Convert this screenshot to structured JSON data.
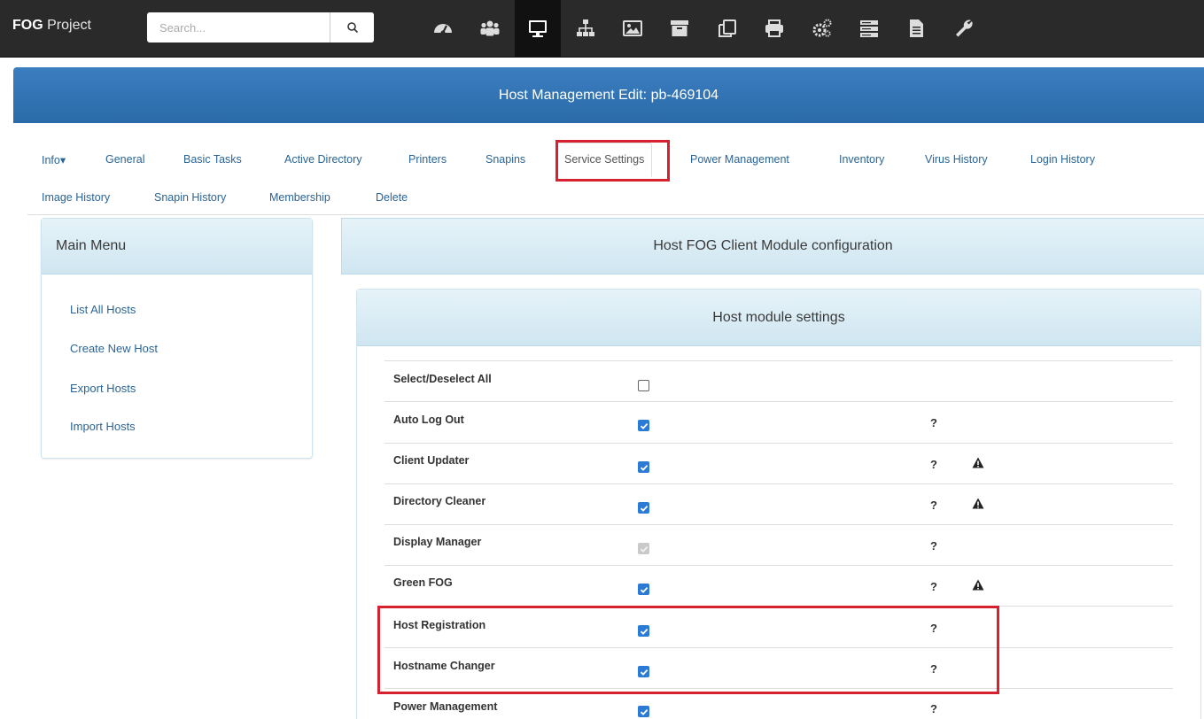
{
  "navbar": {
    "brand_bold": "FOG",
    "brand_rest": " Project",
    "search_placeholder": "Search...",
    "icons": [
      "dashboard-icon",
      "users-icon",
      "monitor-icon",
      "sitemap-icon",
      "image-icon",
      "archive-icon",
      "copy-icon",
      "printer-icon",
      "cogs-icon",
      "server-icon",
      "file-icon",
      "wrench-icon"
    ],
    "active_icon": "monitor-icon"
  },
  "header": {
    "title": "Host Management Edit: pb-469104"
  },
  "tabs": [
    {
      "label": "Info▾"
    },
    {
      "label": "General"
    },
    {
      "label": "Basic Tasks"
    },
    {
      "label": "Active Directory"
    },
    {
      "label": "Printers"
    },
    {
      "label": "Snapins"
    },
    {
      "label": "Service Settings"
    },
    {
      "label": "Power Management"
    },
    {
      "label": "Inventory"
    },
    {
      "label": "Virus History"
    },
    {
      "label": "Login History"
    },
    {
      "label": "Image History"
    },
    {
      "label": "Snapin History"
    },
    {
      "label": "Membership"
    },
    {
      "label": "Delete"
    }
  ],
  "active_tab": "Service Settings",
  "main_menu": {
    "title": "Main Menu",
    "items": [
      "List All Hosts",
      "Create New Host",
      "Export Hosts",
      "Import Hosts"
    ]
  },
  "config": {
    "title": "Host FOG Client Module configuration",
    "section_title": "Host module settings",
    "rows": [
      {
        "label": "Select/Deselect All",
        "state": "unchecked",
        "help": "",
        "warning": false
      },
      {
        "label": "Auto Log Out",
        "state": "checked",
        "help": "?",
        "warning": false
      },
      {
        "label": "Client Updater",
        "state": "checked",
        "help": "?",
        "warning": true
      },
      {
        "label": "Directory Cleaner",
        "state": "checked",
        "help": "?",
        "warning": true
      },
      {
        "label": "Display Manager",
        "state": "disabled",
        "help": "?",
        "warning": false
      },
      {
        "label": "Green FOG",
        "state": "checked",
        "help": "?",
        "warning": true
      },
      {
        "label": "Host Registration",
        "state": "checked",
        "help": "?",
        "warning": false
      },
      {
        "label": "Hostname Changer",
        "state": "checked",
        "help": "?",
        "warning": false
      },
      {
        "label": "Power Management",
        "state": "checked",
        "help": "?",
        "warning": false
      }
    ]
  },
  "colors": {
    "navbar_bg": "#2a2a2a",
    "header_bg": "#2a6aa8",
    "link": "#2a6496",
    "highlight": "#d62230",
    "checkbox": "#2b7ad6"
  }
}
